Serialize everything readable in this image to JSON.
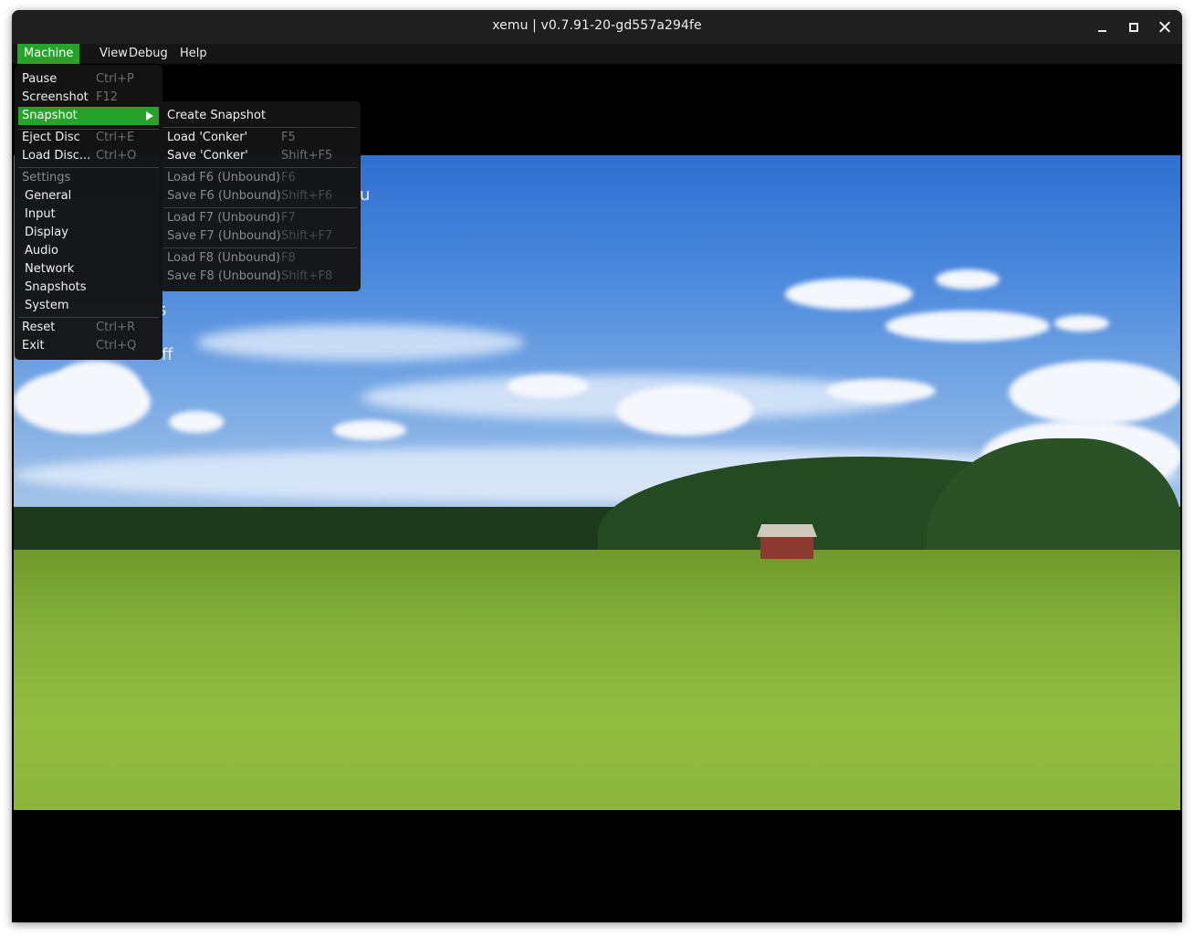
{
  "window": {
    "title": "xemu | v0.7.91-20-gd557a294fe"
  },
  "menubar": {
    "items": [
      "Machine",
      "View",
      "Debug",
      "Help"
    ]
  },
  "machine_menu": {
    "pause": {
      "label": "Pause",
      "shortcut": "Ctrl+P"
    },
    "screenshot": {
      "label": "Screenshot",
      "shortcut": "F12"
    },
    "snapshot": {
      "label": "Snapshot"
    },
    "eject": {
      "label": "Eject Disc",
      "shortcut": "Ctrl+E"
    },
    "load_disc": {
      "label": "Load Disc...",
      "shortcut": "Ctrl+O"
    },
    "settings_heading": "Settings",
    "settings": [
      "General",
      "Input",
      "Display",
      "Audio",
      "Network",
      "Snapshots",
      "System"
    ],
    "reset": {
      "label": "Reset",
      "shortcut": "Ctrl+R"
    },
    "exit": {
      "label": "Exit",
      "shortcut": "Ctrl+Q"
    }
  },
  "snapshot_menu": {
    "create": "Create Snapshot",
    "items": [
      {
        "label": "Load 'Conker'",
        "shortcut": "F5"
      },
      {
        "label": "Save 'Conker'",
        "shortcut": "Shift+F5"
      },
      {
        "label": "Load F6 (Unbound)",
        "shortcut": "F6"
      },
      {
        "label": "Save F6 (Unbound)",
        "shortcut": "Shift+F6"
      },
      {
        "label": "Load F7 (Unbound)",
        "shortcut": "F7"
      },
      {
        "label": "Save F7 (Unbound)",
        "shortcut": "Shift+F7"
      },
      {
        "label": "Load F8 (Unbound)",
        "shortcut": "F8"
      },
      {
        "label": "Save F8 (Unbound)",
        "shortcut": "Shift+F8"
      }
    ]
  },
  "background_text": {
    "fragment1": "u",
    "fragment2": "s",
    "fragment3": "ff"
  },
  "colors": {
    "accent": "#26a32a",
    "menu_bg": "#141414",
    "titlebar_bg": "#1f1f1f"
  },
  "icons": {
    "minimize": "minimize-icon",
    "maximize": "maximize-icon",
    "close": "close-icon",
    "submenu": "triangle-right-icon"
  }
}
